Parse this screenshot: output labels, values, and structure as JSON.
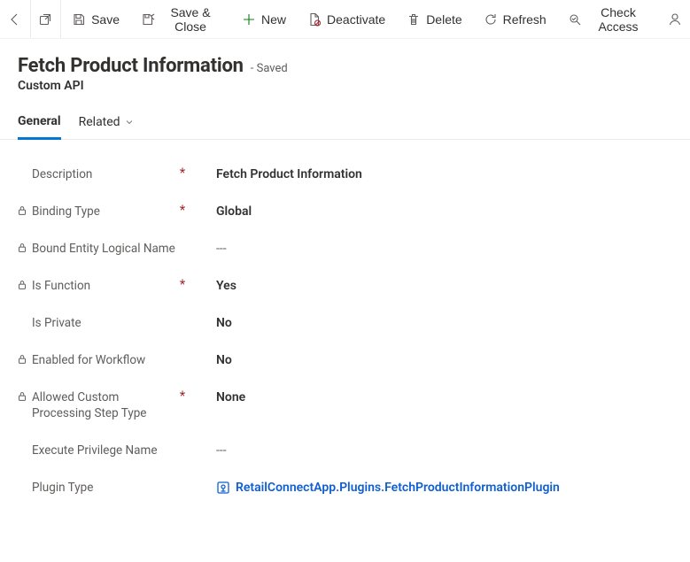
{
  "commandBar": {
    "save": "Save",
    "saveClose": "Save & Close",
    "new": "New",
    "deactivate": "Deactivate",
    "delete": "Delete",
    "refresh": "Refresh",
    "checkAccess": "Check Access"
  },
  "header": {
    "title": "Fetch Product Information",
    "statusSuffix": "- Saved",
    "entity": "Custom API"
  },
  "tabs": {
    "general": "General",
    "related": "Related"
  },
  "fields": {
    "description": {
      "label": "Description",
      "locked": false,
      "required": true,
      "value": "Fetch Product Information"
    },
    "bindingType": {
      "label": "Binding Type",
      "locked": true,
      "required": true,
      "value": "Global"
    },
    "boundEntity": {
      "label": "Bound Entity Logical Name",
      "locked": true,
      "required": false,
      "value": "---"
    },
    "isFunction": {
      "label": "Is Function",
      "locked": true,
      "required": true,
      "value": "Yes"
    },
    "isPrivate": {
      "label": "Is Private",
      "locked": false,
      "required": false,
      "value": "No"
    },
    "enabledWorkflow": {
      "label": "Enabled for Workflow",
      "locked": true,
      "required": false,
      "value": "No"
    },
    "allowedStepType": {
      "label": "Allowed Custom Processing Step Type",
      "locked": true,
      "required": true,
      "value": "None"
    },
    "executePrivilege": {
      "label": "Execute Privilege Name",
      "locked": false,
      "required": false,
      "value": "---"
    },
    "pluginType": {
      "label": "Plugin Type",
      "locked": false,
      "required": false,
      "value": "RetailConnectApp.Plugins.FetchProductInformationPlugin"
    }
  }
}
